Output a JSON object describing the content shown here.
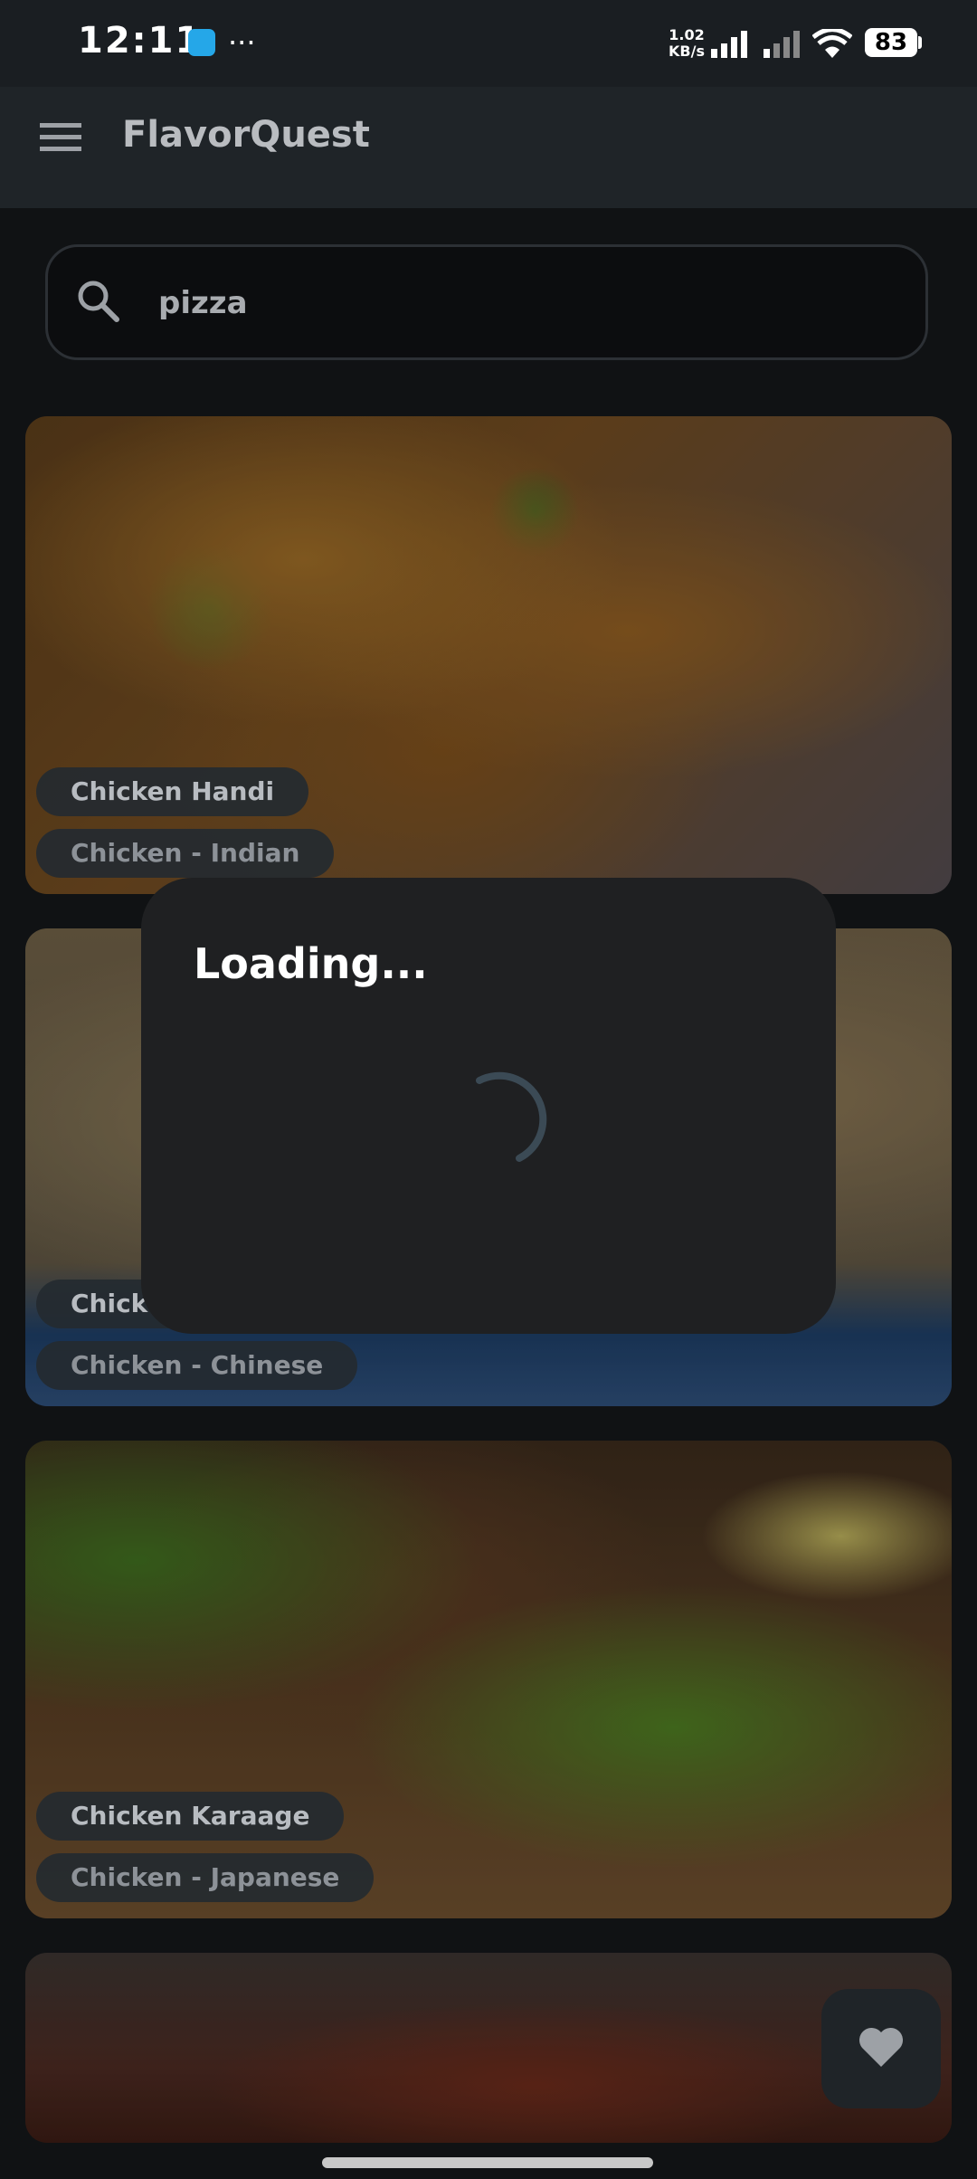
{
  "status_bar": {
    "time": "12:11",
    "network_speed_value": "1.02",
    "network_speed_unit": "KB/s",
    "battery": "83",
    "more_indicator": "···"
  },
  "app_bar": {
    "title": "FlavorQuest"
  },
  "search": {
    "value": "pizza"
  },
  "recipes": [
    {
      "name": "Chicken Handi",
      "category": "Chicken - Indian"
    },
    {
      "name": "Chicke",
      "category": "Chicken - Chinese"
    },
    {
      "name": "Chicken Karaage",
      "category": "Chicken - Japanese"
    }
  ],
  "dialog": {
    "title": "Loading..."
  },
  "colors": {
    "accent": "#1f2428",
    "spinner": "#3b4a55"
  }
}
